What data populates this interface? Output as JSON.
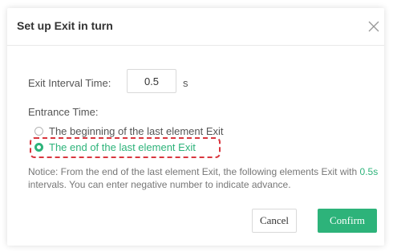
{
  "dialog": {
    "title": "Set up Exit in turn",
    "close_icon": "close-icon"
  },
  "interval": {
    "label": "Exit Interval Time:",
    "value": "0.5",
    "unit": "s"
  },
  "entrance": {
    "label": "Entrance Time:",
    "options": [
      {
        "label": "The beginning of the last element Exit",
        "selected": false
      },
      {
        "label": "The end of the last element Exit",
        "selected": true
      }
    ]
  },
  "notice": {
    "prefix": "Notice: From the end of the last element Exit, the following elements Exit with ",
    "highlight": "0.5s",
    "suffix": " intervals. You can enter negative number to indicate advance."
  },
  "buttons": {
    "cancel": "Cancel",
    "confirm": "Confirm"
  },
  "colors": {
    "accent": "#2db37a",
    "highlight_border": "#d9363e"
  }
}
